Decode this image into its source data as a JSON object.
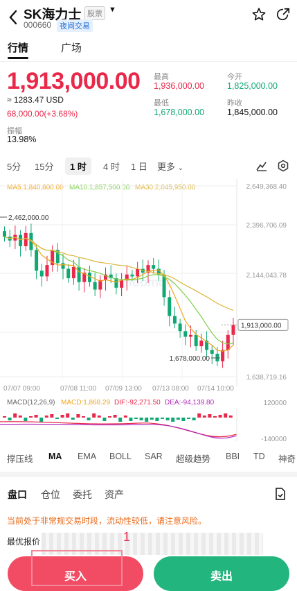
{
  "header": {
    "title": "SK海力士",
    "market_tag": "股票",
    "code": "000660",
    "session_tag": "夜间交易"
  },
  "tabs": [
    "行情",
    "广场"
  ],
  "quote": {
    "price": "1,913,000.00",
    "usd": "≈ 1283.47 USD",
    "change": "68,000.00(+3.68%)",
    "amplitude_label": "振幅",
    "amplitude": "13.98%",
    "high_label": "最高",
    "high": "1,936,000.00",
    "open_label": "今开",
    "open": "1,825,000.00",
    "low_label": "最低",
    "low": "1,678,000.00",
    "prev_close_label": "昨收",
    "prev_close": "1,845,000.00"
  },
  "periods": [
    "5分",
    "15分",
    "1 时",
    "4 时",
    "1 日",
    "更多"
  ],
  "ma_legend": {
    "ma5": "MA5:1,840,800.00",
    "ma10": "MA10:1,857,500.00",
    "ma30": "MA30:2,045,950.00"
  },
  "chart": {
    "y_ticks": [
      "2,649,368.40",
      "2,396,706.09",
      "2,144,043.78",
      "1,638,719.16"
    ],
    "x_ticks": [
      "07/07 09:00",
      "07/08 11:00",
      "07/09 13:00",
      "07/13 08:00",
      "07/14 10:00"
    ],
    "high_marker": "2,462,000.00",
    "low_marker": "1,678,000.00",
    "last_marker": "1,913,000.00",
    "watermark": "moomoo"
  },
  "macd_legend": {
    "params": "MACD(12,26,9)",
    "macd": "MACD:1,868.29",
    "dif": "DIF:-92,271.50",
    "dea": "DEA:-94,139.80",
    "top": "120000",
    "bottom": "-140000"
  },
  "indicators": [
    "撑压线",
    "MA",
    "EMA",
    "BOLL",
    "SAR",
    "超级趋势",
    "BBI",
    "TD",
    "神奇"
  ],
  "sections": [
    "盘口",
    "仓位",
    "委托",
    "资产"
  ],
  "warning": "当前处于非常规交易时段，流动性较低，请注意风险。",
  "best_quote_label": "最优报价",
  "annotation_number": "1",
  "buttons": {
    "buy": "买入",
    "sell": "卖出"
  },
  "colors": {
    "up": "#e8294a",
    "down": "#12a873",
    "ma5": "#f2a51a",
    "ma10": "#7ed04a",
    "ma30": "#ddb53a"
  },
  "chart_data": {
    "type": "candlestick",
    "ylim": [
      1638719.16,
      2649368.4
    ],
    "closes_approx": [
      2380000,
      2360000,
      2390000,
      2330000,
      2400000,
      2310000,
      2200000,
      2170000,
      2230000,
      2310000,
      2240000,
      2210000,
      2160000,
      2220000,
      2140000,
      2190000,
      2140000,
      2100000,
      2150000,
      2180000,
      2160000,
      2110000,
      2150000,
      2180000,
      2170000,
      2210000,
      2190000,
      2230000,
      2210000,
      2180000,
      2060000,
      1960000,
      1920000,
      1880000,
      1850000,
      1860000,
      1800000,
      1830000,
      1780000,
      1760000,
      1720000,
      1780000,
      1860000,
      1913000
    ]
  }
}
